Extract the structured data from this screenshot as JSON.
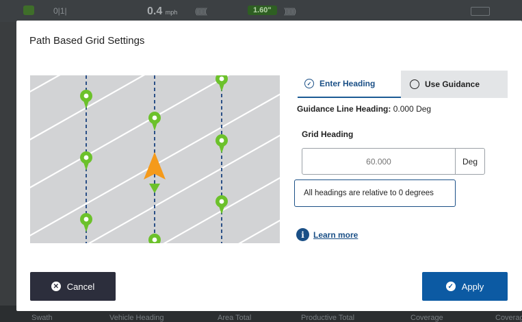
{
  "app": {
    "speed_value": "0.4",
    "speed_unit": "mph",
    "offline_badge": "1.60\"",
    "left_readout": "0|1|"
  },
  "dialog": {
    "title": "Path Based Grid Settings",
    "tabs": {
      "enter_heading": "Enter Heading",
      "use_guidance": "Use Guidance"
    },
    "guidance_line_label": "Guidance Line Heading:",
    "guidance_line_value": "0.000 Deg",
    "grid_heading_label": "Grid Heading",
    "grid_heading_placeholder": "60.000",
    "grid_heading_unit": "Deg",
    "tooltip": "All headings are relative to 0 degrees",
    "learn_more": "Learn more",
    "cancel_label": "Cancel",
    "apply_label": "Apply"
  },
  "bottom_bar": {
    "labels": [
      "Swath",
      "Vehicle Heading",
      "Area Total",
      "Productive Total",
      "Coverage",
      "Coverage"
    ]
  },
  "colors": {
    "accent": "#0c5aa3",
    "cancel_bg": "#2c2e3c",
    "marker_green": "#6cc12b",
    "vehicle_orange": "#f59a1b"
  },
  "icons": {
    "tab_heading": "compass-icon",
    "tab_guidance": "radio-icon",
    "info": "info-icon",
    "cancel": "close-circle-icon",
    "apply": "check-circle-icon"
  }
}
